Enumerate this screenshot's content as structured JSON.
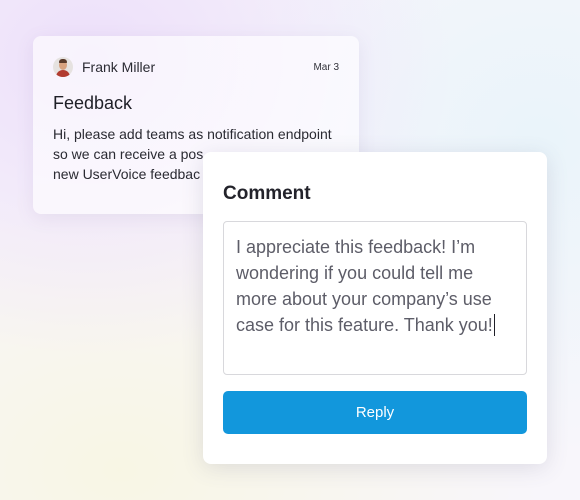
{
  "feedback": {
    "author": "Frank Miller",
    "date": "Mar 3",
    "title": "Feedback",
    "body_lines": [
      "Hi, please add teams as notification endpoint",
      "so we can receive a pos",
      "new UserVoice feedbac"
    ]
  },
  "comment": {
    "title": "Comment",
    "text": "I appreciate this feedback! I’m wondering if you could tell me more about your company’s use case for this feature. Thank you!",
    "reply_label": "Reply"
  },
  "colors": {
    "reply_button": "#1297dc",
    "avatar_shirt": "#b23b30"
  },
  "icons": {
    "avatar": "user-avatar-icon"
  }
}
